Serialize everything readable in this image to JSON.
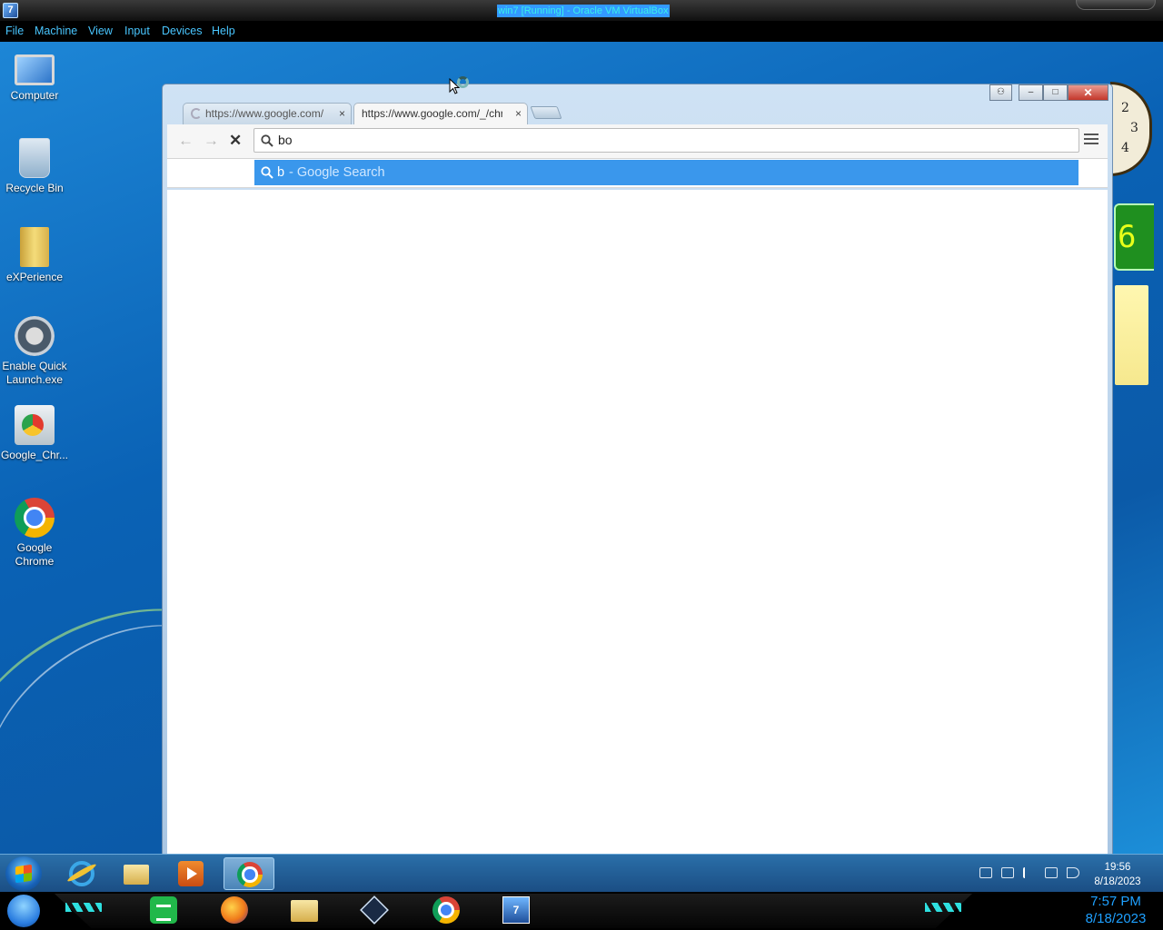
{
  "vbox": {
    "title": "win7 [Running] - Oracle VM VirtualBox",
    "menu": [
      "File",
      "Machine",
      "View",
      "Input",
      "Devices",
      "Help"
    ]
  },
  "desktop": {
    "icons": [
      {
        "label": "Computer",
        "icon": "computer-icon"
      },
      {
        "label": "Recycle Bin",
        "icon": "recycle-bin-icon"
      },
      {
        "label": "eXPerience",
        "icon": "folder-icon"
      },
      {
        "label": "Enable Quick Launch.exe",
        "icon": "quick-launch-icon"
      },
      {
        "label": "Google_Chr...",
        "icon": "installer-icon"
      },
      {
        "label": "Google Chrome",
        "icon": "chrome-icon"
      }
    ],
    "gadgets": {
      "clock_numbers": [
        "2",
        "3",
        "4"
      ],
      "cpu_digit": "6"
    }
  },
  "chrome": {
    "window_buttons": {
      "minimize": "–",
      "maximize": "□",
      "close": "✕",
      "user": "⚇"
    },
    "tabs": [
      {
        "title": "https://www.google.com/",
        "close": "×"
      },
      {
        "title": "https://www.google.com/_/chrome/newtab",
        "close": "×"
      }
    ],
    "nav": {
      "back": "←",
      "forward": "→",
      "stop": "✕"
    },
    "omnibox": {
      "value": "bo"
    },
    "suggestion": {
      "query": "b",
      "description": " - Google Search"
    }
  },
  "taskbar": {
    "items": [
      "internet-explorer-icon",
      "windows-explorer-icon",
      "media-player-icon",
      "chrome-icon"
    ],
    "clock_time": "19:56",
    "clock_date": "8/18/2023"
  },
  "dock": {
    "items": [
      "start-orb-icon",
      "notes-icon",
      "firefox-icon",
      "folder-icon",
      "virtualbox-icon",
      "chrome-icon",
      "vm-icon"
    ],
    "vm_badge": "7",
    "clock_time": "7:57 PM",
    "clock_date": "8/18/2023"
  }
}
